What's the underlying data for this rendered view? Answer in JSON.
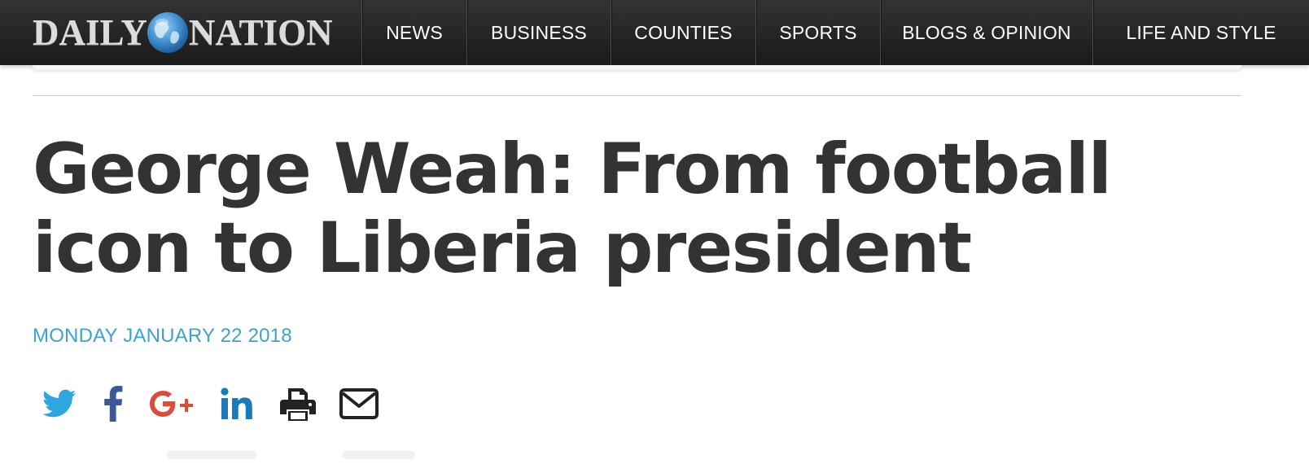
{
  "header": {
    "logo_left": "DAILY",
    "logo_right": "NATION",
    "nav": [
      "NEWS",
      "BUSINESS",
      "COUNTIES",
      "SPORTS",
      "BLOGS & OPINION",
      "LIFE AND STYLE"
    ]
  },
  "article": {
    "headline": "George Weah: From football icon to Liberia president",
    "date": "MONDAY JANUARY 22 2018"
  },
  "share_icons": [
    "twitter-icon",
    "facebook-icon",
    "google-plus-icon",
    "linkedin-icon",
    "print-icon",
    "email-icon"
  ],
  "colors": {
    "navbar": "#262424",
    "headline": "#333333",
    "date": "#3ea2d0",
    "twitter": "#2ea7e0",
    "facebook": "#3b5998",
    "google_plus": "#dd4b39",
    "linkedin": "#1b7ab8",
    "print_mail": "#222222"
  }
}
